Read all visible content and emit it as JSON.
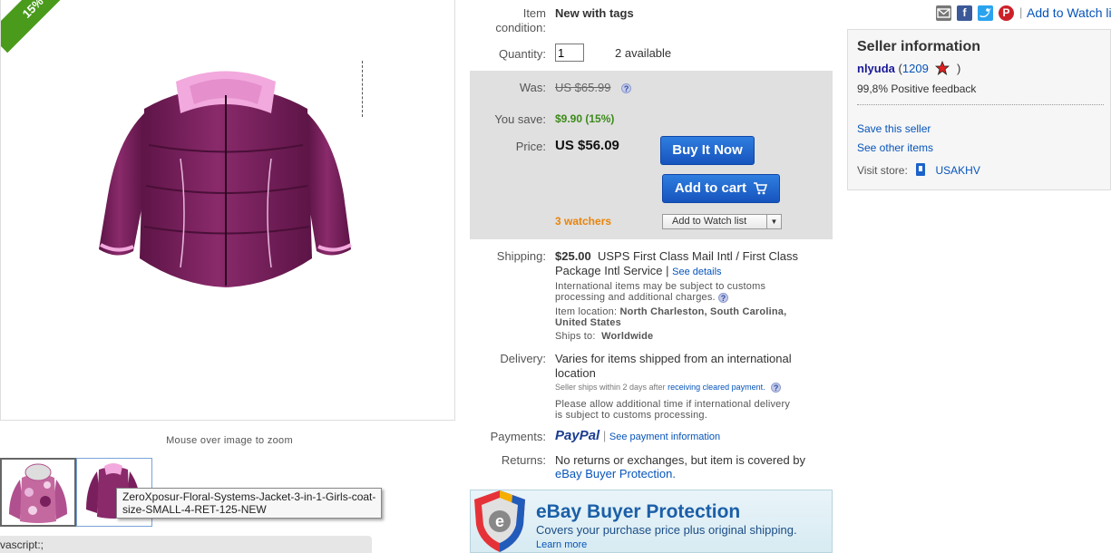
{
  "product": {
    "discount_badge": "15%",
    "zoom_hint": "Mouse over image to zoom",
    "tooltip_line1": "ZeroXposur-Floral-Systems-Jacket-3-in-1-Girls-coat-",
    "tooltip_line2": "size-SMALL-4-RET-125-NEW",
    "status_bar_text": "vascript:;",
    "jacket_color": "#7a1f5e",
    "collar_color": "#f2a9dd"
  },
  "details": {
    "condition_label_1": "Item",
    "condition_label_2": "condition:",
    "condition_value": "New with tags",
    "quantity_label": "Quantity:",
    "quantity_value": "1",
    "available": "2 available",
    "was_label": "Was:",
    "was_value": "US $65.99",
    "save_label": "You save:",
    "save_value": "$9.90 (15%)",
    "price_label": "Price:",
    "price_value": "US $56.09",
    "buy_now": "Buy It Now",
    "add_to_cart": "Add to cart",
    "watchers": "3 watchers",
    "add_to_watch": "Add to Watch list",
    "shipping_label": "Shipping:",
    "shipping_cost": "$25.00",
    "shipping_service_1": "USPS First Class Mail Intl / First Class",
    "shipping_service_2": "Package Intl Service |",
    "see_details": "See details",
    "customs_1": "International items may be subject to customs",
    "customs_2": "processing and additional charges.",
    "location_label": "Item location:",
    "location_value_1": "North Charleston, South Carolina,",
    "location_value_2": "United States",
    "ships_to_label": "Ships to:",
    "ships_to_value": "Worldwide",
    "delivery_label": "Delivery:",
    "delivery_1": "Varies for items shipped from an international",
    "delivery_2": "location",
    "seller_ships_prefix": "Seller ships within 2 days after",
    "seller_ships_link": "receiving cleared payment.",
    "allow_1": "Please allow additional time if international delivery",
    "allow_2": "is subject to customs processing.",
    "payments_label": "Payments:",
    "paypal": "PayPal",
    "see_payment": "See payment information",
    "returns_label": "Returns:",
    "returns_1": "No returns or exchanges, but item is covered by",
    "returns_2": "eBay Buyer Protection."
  },
  "protection_banner": {
    "title": "eBay Buyer Protection",
    "subtitle": "Covers your purchase price plus original shipping.",
    "learn_more": "Learn more"
  },
  "share": {
    "watch_link": "Add to Watch list",
    "facebook_glyph": "f",
    "pinterest_glyph": "P"
  },
  "seller": {
    "heading": "Seller information",
    "name": "nlyuda",
    "score_prefix": "(",
    "score": "1209",
    "score_suffix": ")",
    "feedback": "99,8% Positive feedback",
    "save_seller": "Save this seller",
    "see_other": "See other items",
    "visit_label": "Visit store:",
    "store_name": "USAKHV"
  },
  "colors": {
    "link": "#0654ba",
    "green": "#4a9a1c",
    "orange": "#e8840c",
    "button_blue": "#1c62c9"
  }
}
